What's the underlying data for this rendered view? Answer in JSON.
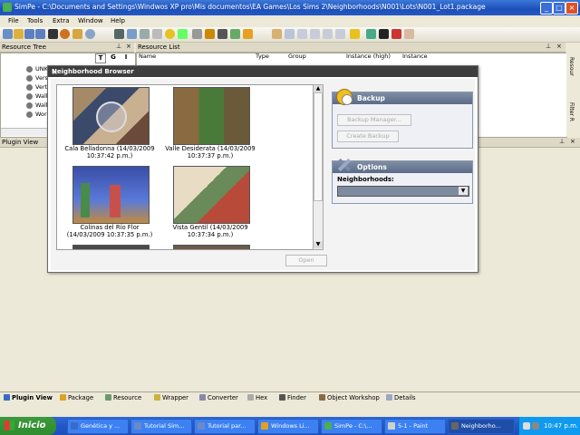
{
  "window": {
    "title": "SimPe - C:\\Documents and Settings\\Windwos XP pro\\Mis documentos\\EA Games\\Los Sims 2\\Neighborhoods\\N001\\Lots\\N001_Lot1.package",
    "min": "_",
    "max": "□",
    "close": "×"
  },
  "menu": [
    "File",
    "Tools",
    "Extra",
    "Window",
    "Help"
  ],
  "resource_tree": {
    "title": "Resource Tree",
    "buttons": [
      "T",
      "G",
      "I"
    ],
    "items": [
      "UNK:",
      "Versi",
      "Verte",
      "Wall",
      "Wall l",
      "Worl"
    ]
  },
  "resource_list": {
    "title": "Resource List",
    "columns": [
      "Name",
      "Type",
      "Group",
      "Instance (high)",
      "Instance"
    ]
  },
  "plugin_view_title": "Plugin View",
  "side_tabs": [
    "Resour",
    "Filter R"
  ],
  "dialog": {
    "title": "Neighborhood Browser",
    "close": "×",
    "neighborhoods": [
      {
        "name": "Cala Belladonna (14/03/2009",
        "time": "10:37:42 p.m.)"
      },
      {
        "name": "Valle Desiderata (14/03/2009",
        "time": "10:37:37 p.m.)"
      },
      {
        "name": "Colinas del Río Flor",
        "time": "(14/03/2009 10:37:35 p.m.)"
      },
      {
        "name": "Vista Gentil (14/03/2009",
        "time": "10:37:34 p.m.)"
      }
    ],
    "open_button": "Open",
    "backup": {
      "title": "Backup",
      "manager_button": "Backup Manager...",
      "create_button": "Create Backup"
    },
    "options": {
      "title": "Options",
      "label": "Neighborhoods:",
      "selected": ""
    }
  },
  "bottom_tabs": [
    "Plugin View",
    "Package",
    "Resource",
    "Wrapper",
    "Converter",
    "Hex",
    "Finder",
    "Object Workshop",
    "Details"
  ],
  "taskbar": {
    "start": "Inicio",
    "tasks": [
      "Genética y ...",
      "Tutorial Sim...",
      "Tutorial par...",
      "Windows Li...",
      "SimPe - C:\\...",
      "5-1 - Paint",
      "Neighborho..."
    ],
    "clock": "10:47 p.m."
  }
}
